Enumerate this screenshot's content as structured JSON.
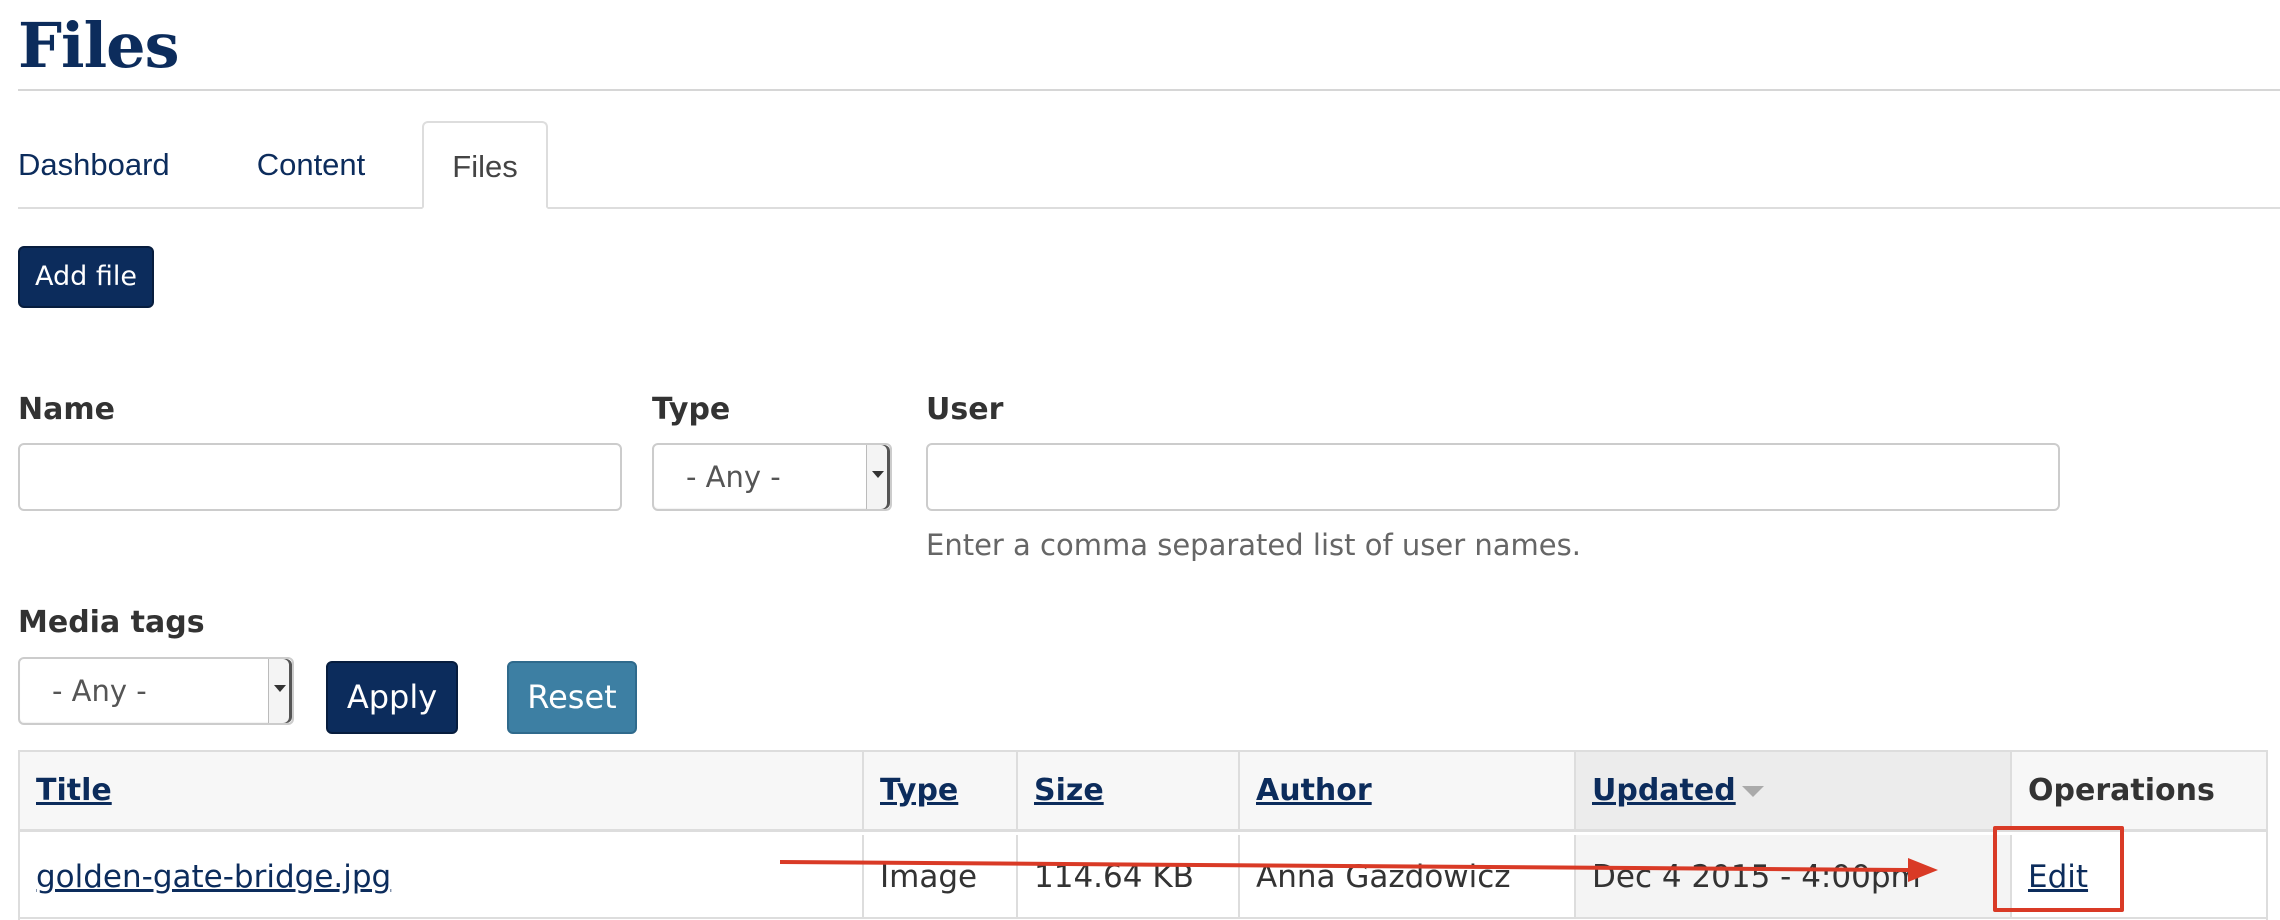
{
  "page": {
    "title": "Files"
  },
  "tabs": [
    {
      "label": "Dashboard",
      "active": false
    },
    {
      "label": "Content",
      "active": false
    },
    {
      "label": "Files",
      "active": true
    }
  ],
  "toolbar": {
    "add_file_label": "Add file"
  },
  "filters": {
    "name": {
      "label": "Name",
      "value": ""
    },
    "type": {
      "label": "Type",
      "selected": "- Any -"
    },
    "user": {
      "label": "User",
      "value": "",
      "help": "Enter a comma separated list of user names."
    },
    "media_tags": {
      "label": "Media tags",
      "selected": "- Any -"
    },
    "apply_label": "Apply",
    "reset_label": "Reset"
  },
  "table": {
    "columns": [
      "Title",
      "Type",
      "Size",
      "Author",
      "Updated",
      "Operations"
    ],
    "rows": [
      {
        "title": "golden-gate-bridge.jpg",
        "type": "Image",
        "size": "114.64 KB",
        "author": "Anna Gazdowicz",
        "updated": "Dec 4 2015 - 4:00pm",
        "operation": "Edit"
      }
    ]
  },
  "colors": {
    "brand": "#0c2c5c",
    "reset_button": "#3d7fa3",
    "annotation": "#d93a26"
  }
}
